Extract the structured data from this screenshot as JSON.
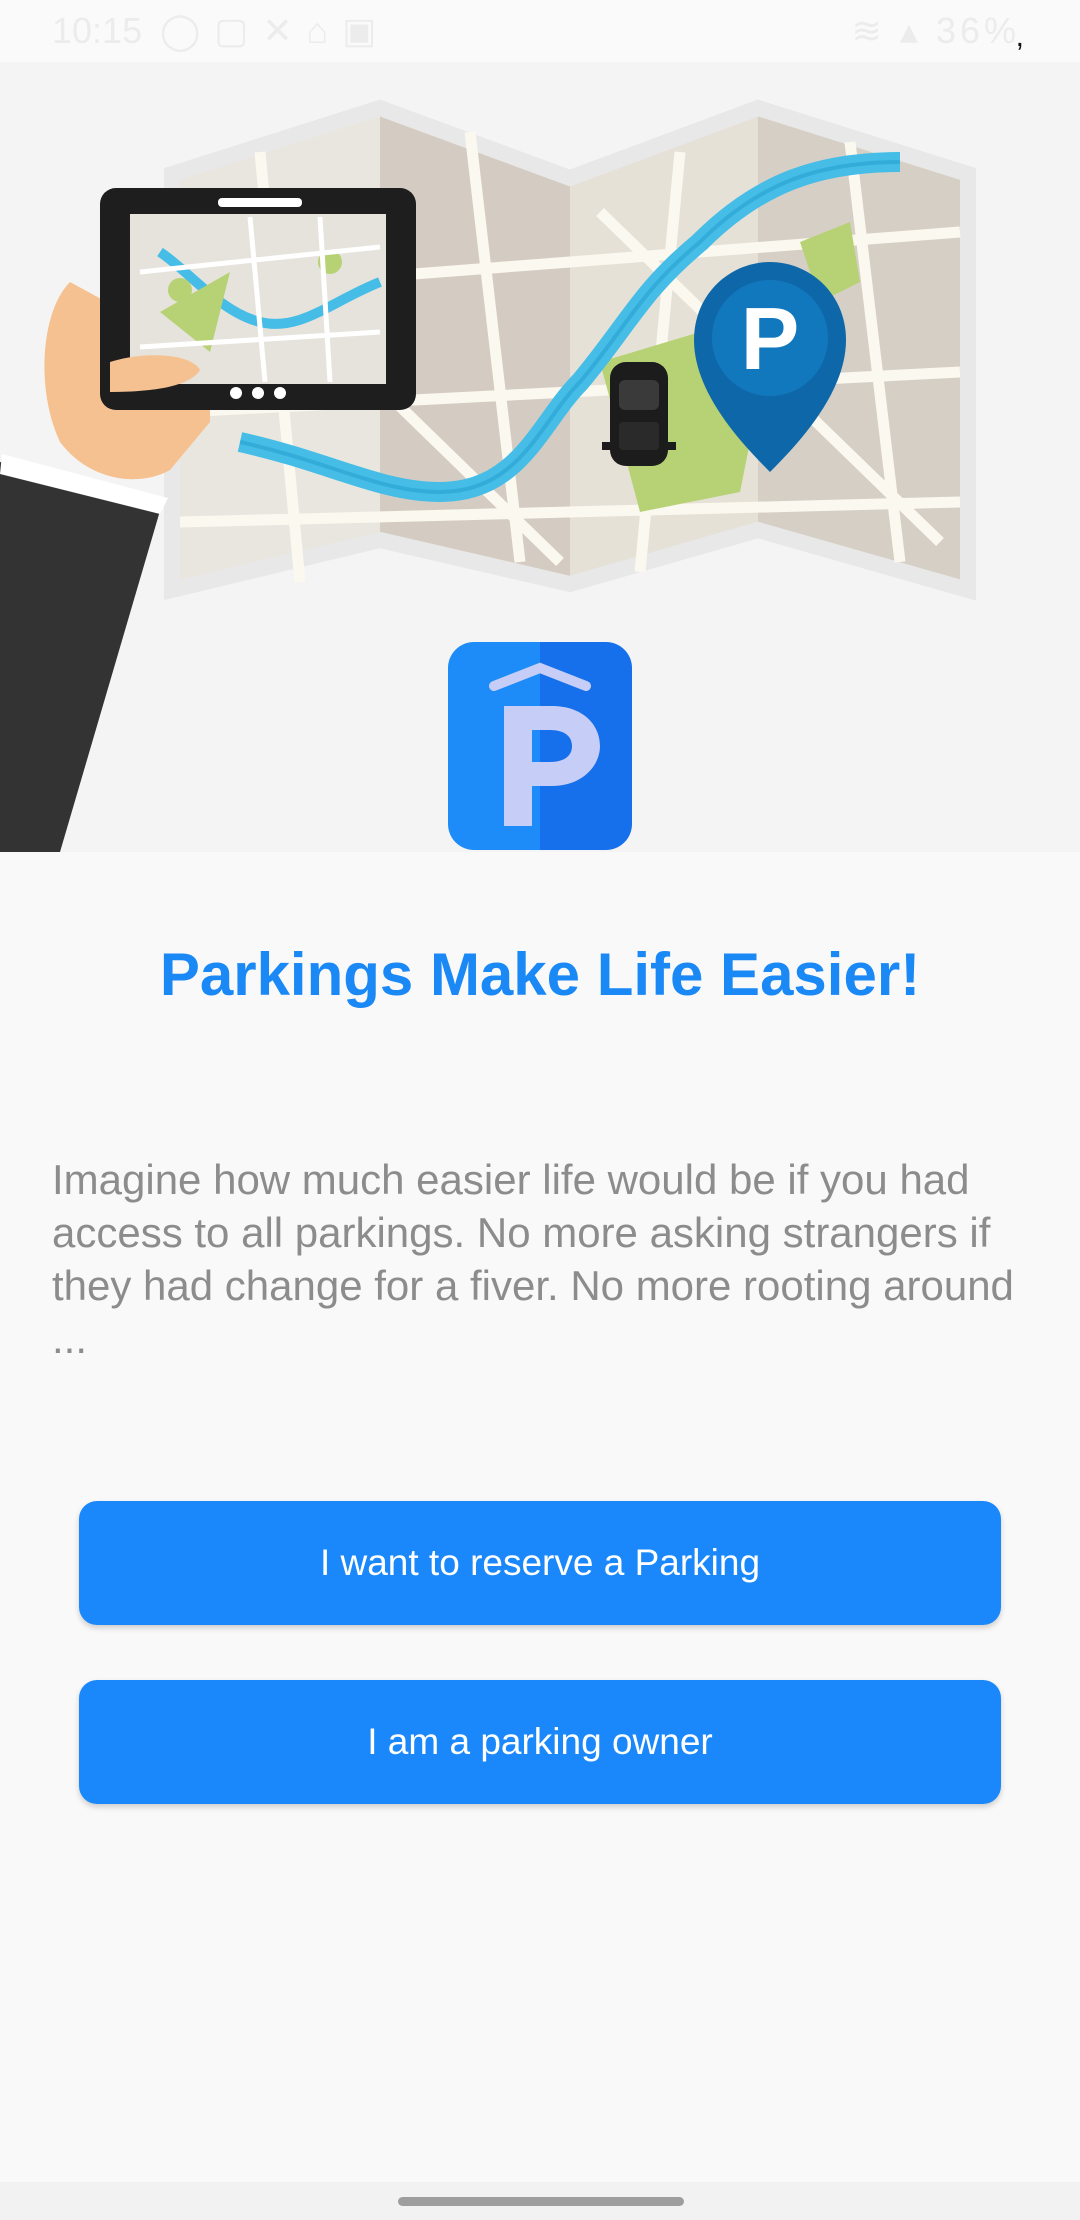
{
  "status_bar": {
    "time": "10:15",
    "notification_icons": [
      "whatsapp-icon",
      "instagram-icon",
      "x-icon",
      "home-icon",
      "gallery-icon"
    ],
    "battery": "36%"
  },
  "hero": {
    "illustration": "map-with-tablet-car-and-parking-pin",
    "pin_letter": "P"
  },
  "logo": {
    "letter": "P"
  },
  "headline": "Parkings Make Life Easier!",
  "description": "Imagine how much easier life would be if you had access to all parkings. No more asking strangers if they had change for a fiver. No more rooting around ...",
  "buttons": {
    "reserve": "I want to reserve a Parking",
    "owner": "I am a parking owner"
  },
  "colors": {
    "accent": "#1a88f5",
    "button": "#1a88fb",
    "description": "#8c8c8c",
    "background": "#f9f9f9"
  }
}
